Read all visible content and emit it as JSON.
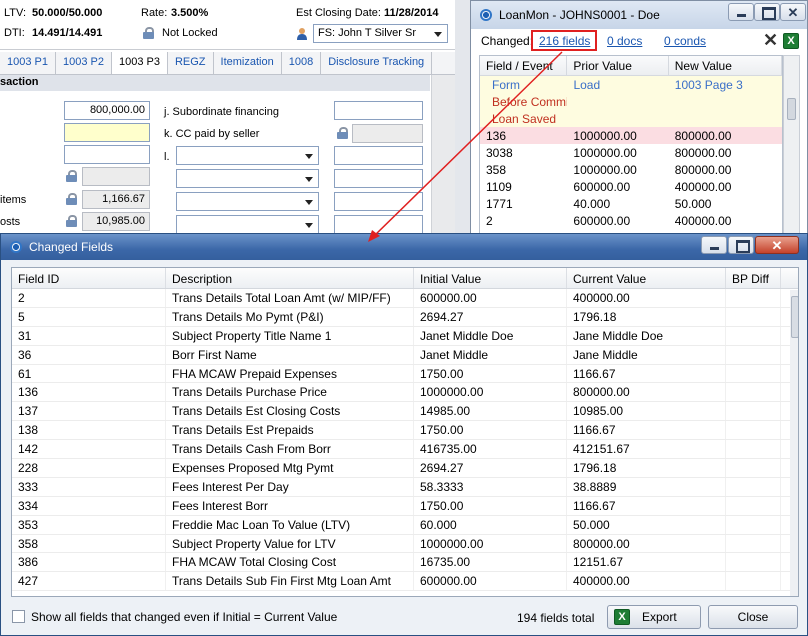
{
  "form_header": {
    "ltv_label": "LTV:",
    "ltv_value": "50.000/50.000",
    "dti_label": "DTI:",
    "dti_value": "14.491/14.491",
    "rate_label": "Rate:",
    "rate_value": "3.500%",
    "lock_status": "Not Locked",
    "est_closing_label": "Est Closing Date:",
    "est_closing_value": "11/28/2014",
    "fs_value": "FS: John T Silver Sr"
  },
  "form_tabs": [
    "1003 P1",
    "1003 P2",
    "1003 P3",
    "REGZ",
    "Itemization",
    "1008",
    "Disclosure Tracking"
  ],
  "form_active_tab": "1003 P3",
  "form_section_title": "saction",
  "form_fields": {
    "purchase_price": "800,000.00",
    "subordinate_label": "j. Subordinate financing",
    "cc_paid_label": "k. CC paid by seller",
    "l_label": "l.",
    "items_label": "items",
    "items_value": "1,166.67",
    "costs_label": "osts",
    "costs_value": "10,985.00"
  },
  "loanmon": {
    "title": "LoanMon - JOHNS0001 - Doe",
    "changed_label": "Changed:",
    "fields_link": "216 fields",
    "docs_link": "0 docs",
    "conds_link": "0 conds",
    "excel_icon_text": "X",
    "columns": [
      "Field / Event",
      "Prior Value",
      "New Value"
    ],
    "rows": [
      {
        "field": "Form",
        "prior": "Load",
        "new": "1003 Page 3",
        "kind": "event-blue"
      },
      {
        "field": "Before Commit",
        "prior": "",
        "new": "",
        "kind": "event-red"
      },
      {
        "field": "Loan Saved",
        "prior": "",
        "new": "",
        "kind": "event-red"
      },
      {
        "field": "136",
        "prior": "1000000.00",
        "new": "800000.00",
        "kind": "highlight"
      },
      {
        "field": "3038",
        "prior": "1000000.00",
        "new": "800000.00",
        "kind": "normal"
      },
      {
        "field": "358",
        "prior": "1000000.00",
        "new": "800000.00",
        "kind": "normal"
      },
      {
        "field": "1109",
        "prior": "600000.00",
        "new": "400000.00",
        "kind": "normal"
      },
      {
        "field": "1771",
        "prior": "40.000",
        "new": "50.000",
        "kind": "normal"
      },
      {
        "field": "2",
        "prior": "600000.00",
        "new": "400000.00",
        "kind": "normal"
      }
    ]
  },
  "dialog": {
    "title": "Changed Fields",
    "columns": [
      "Field ID",
      "Description",
      "Initial Value",
      "Current Value",
      "BP Diff"
    ],
    "rows": [
      {
        "id": "2",
        "desc": "Trans Details Total Loan Amt (w/ MIP/FF)",
        "initial": "600000.00",
        "current": "400000.00",
        "bp": ""
      },
      {
        "id": "5",
        "desc": "Trans Details Mo Pymt (P&I)",
        "initial": "2694.27",
        "current": "1796.18",
        "bp": ""
      },
      {
        "id": "31",
        "desc": "Subject Property Title Name 1",
        "initial": "Janet Middle Doe",
        "current": "Jane Middle Doe",
        "bp": ""
      },
      {
        "id": "36",
        "desc": "Borr First Name",
        "initial": "Janet Middle",
        "current": "Jane Middle",
        "bp": ""
      },
      {
        "id": "61",
        "desc": "FHA MCAW Prepaid Expenses",
        "initial": "1750.00",
        "current": "1166.67",
        "bp": ""
      },
      {
        "id": "136",
        "desc": "Trans Details Purchase Price",
        "initial": "1000000.00",
        "current": "800000.00",
        "bp": ""
      },
      {
        "id": "137",
        "desc": "Trans Details Est Closing Costs",
        "initial": "14985.00",
        "current": "10985.00",
        "bp": ""
      },
      {
        "id": "138",
        "desc": "Trans Details Est Prepaids",
        "initial": "1750.00",
        "current": "1166.67",
        "bp": ""
      },
      {
        "id": "142",
        "desc": "Trans Details Cash From Borr",
        "initial": "416735.00",
        "current": "412151.67",
        "bp": ""
      },
      {
        "id": "228",
        "desc": "Expenses Proposed Mtg Pymt",
        "initial": "2694.27",
        "current": "1796.18",
        "bp": ""
      },
      {
        "id": "333",
        "desc": "Fees Interest Per Day",
        "initial": "58.3333",
        "current": "38.8889",
        "bp": ""
      },
      {
        "id": "334",
        "desc": "Fees Interest Borr",
        "initial": "1750.00",
        "current": "1166.67",
        "bp": ""
      },
      {
        "id": "353",
        "desc": "Freddie Mac Loan To Value (LTV)",
        "initial": "60.000",
        "current": "50.000",
        "bp": ""
      },
      {
        "id": "358",
        "desc": "Subject Property Value for LTV",
        "initial": "1000000.00",
        "current": "800000.00",
        "bp": ""
      },
      {
        "id": "386",
        "desc": "FHA MCAW Total Closing Cost",
        "initial": "16735.00",
        "current": "12151.67",
        "bp": ""
      },
      {
        "id": "427",
        "desc": "Trans Details Sub Fin First Mtg Loan Amt",
        "initial": "600000.00",
        "current": "400000.00",
        "bp": ""
      }
    ],
    "show_all_label": "Show all fields that changed even if Initial = Current Value",
    "total_text": "194 fields total",
    "export_label": "Export",
    "close_label": "Close"
  },
  "colors": {
    "accent": "#1a56b0",
    "annotation": "#e02020",
    "dialog_titlebar": "#3b67a8"
  }
}
